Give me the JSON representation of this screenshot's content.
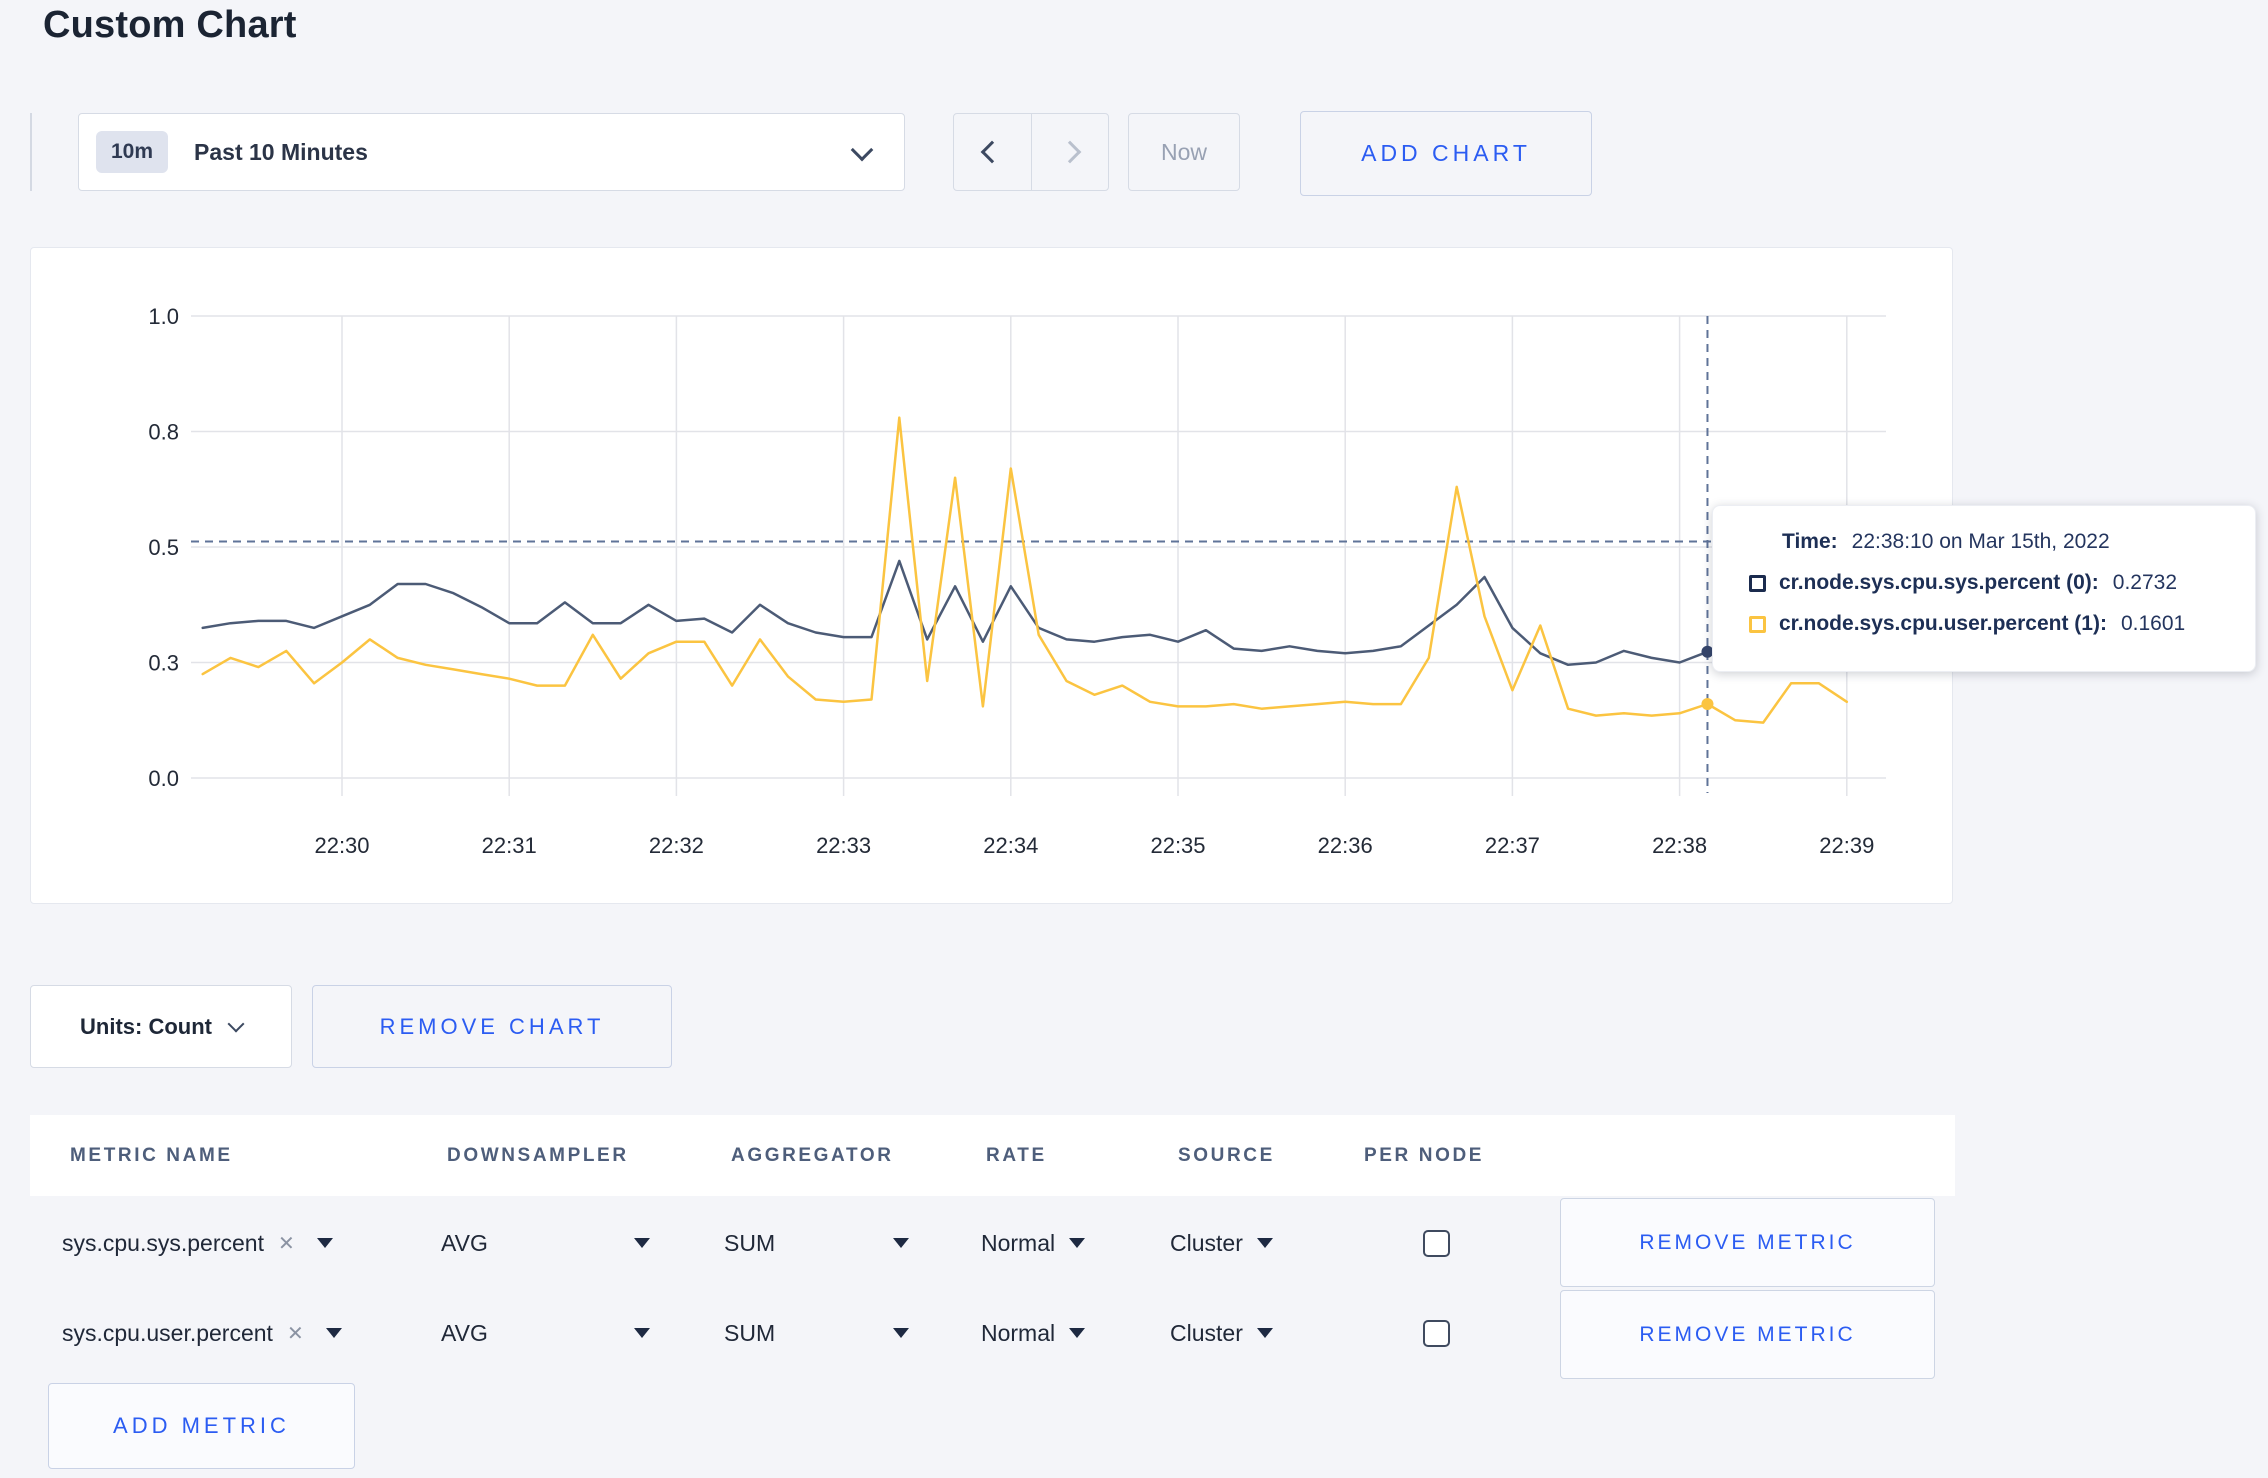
{
  "page": {
    "title": "Custom Chart"
  },
  "toolbar": {
    "time_badge": "10m",
    "time_label": "Past 10 Minutes",
    "now_label": "Now",
    "add_chart_label": "ADD CHART"
  },
  "chart_controls": {
    "units_label": "Units: Count",
    "remove_chart_label": "REMOVE CHART",
    "add_metric_label": "ADD METRIC"
  },
  "tooltip": {
    "time_label": "Time:",
    "time_value": "22:38:10 on Mar 15th, 2022",
    "rows": [
      {
        "label": "cr.node.sys.cpu.sys.percent (0):",
        "value": "0.2732",
        "color": "#1b2b4e"
      },
      {
        "label": "cr.node.sys.cpu.user.percent (1):",
        "value": "0.1601",
        "color": "#fbc441"
      }
    ]
  },
  "table": {
    "headers": [
      "METRIC NAME",
      "DOWNSAMPLER",
      "AGGREGATOR",
      "RATE",
      "SOURCE",
      "PER NODE"
    ],
    "rows": [
      {
        "metric": "sys.cpu.sys.percent",
        "downsampler": "AVG",
        "aggregator": "SUM",
        "rate": "Normal",
        "source": "Cluster",
        "per_node_checked": false,
        "remove_label": "REMOVE METRIC"
      },
      {
        "metric": "sys.cpu.user.percent",
        "downsampler": "AVG",
        "aggregator": "SUM",
        "rate": "Normal",
        "source": "Cluster",
        "per_node_checked": false,
        "remove_label": "REMOVE METRIC"
      }
    ]
  },
  "chart_data": {
    "type": "line",
    "title": "",
    "grid": true,
    "legend_position": "none",
    "x_axis": {
      "tick_labels": [
        "22:30",
        "22:31",
        "22:32",
        "22:33",
        "22:34",
        "22:35",
        "22:36",
        "22:37",
        "22:38",
        "22:39"
      ],
      "start_time": "22:29:10",
      "interval_sec": 10
    },
    "y_axis": {
      "tick_labels": [
        "0.0",
        "0.3",
        "0.5",
        "0.8",
        "1.0"
      ],
      "tick_values": [
        0,
        0.25,
        0.5,
        0.75,
        1.0
      ],
      "range": [
        0,
        1
      ]
    },
    "series": [
      {
        "name": "cr.node.sys.cpu.sys.percent",
        "color": "#4c5b76",
        "values": [
          0.325,
          0.335,
          0.34,
          0.34,
          0.325,
          0.35,
          0.375,
          0.42,
          0.42,
          0.4,
          0.37,
          0.335,
          0.335,
          0.38,
          0.335,
          0.335,
          0.375,
          0.34,
          0.345,
          0.315,
          0.375,
          0.335,
          0.315,
          0.305,
          0.305,
          0.47,
          0.3,
          0.415,
          0.295,
          0.415,
          0.325,
          0.3,
          0.295,
          0.305,
          0.31,
          0.295,
          0.32,
          0.28,
          0.275,
          0.285,
          0.275,
          0.27,
          0.275,
          0.285,
          0.33,
          0.375,
          0.435,
          0.325,
          0.27,
          0.245,
          0.25,
          0.275,
          0.26,
          0.25,
          0.2732,
          0.26,
          0.28,
          0.3,
          0.295,
          0.3
        ]
      },
      {
        "name": "cr.node.sys.cpu.user.percent",
        "color": "#fbc441",
        "values": [
          0.225,
          0.26,
          0.24,
          0.275,
          0.205,
          0.25,
          0.3,
          0.26,
          0.245,
          0.235,
          0.225,
          0.215,
          0.2,
          0.2,
          0.31,
          0.215,
          0.27,
          0.295,
          0.295,
          0.2,
          0.3,
          0.22,
          0.17,
          0.165,
          0.17,
          0.78,
          0.21,
          0.65,
          0.155,
          0.67,
          0.31,
          0.21,
          0.18,
          0.2,
          0.165,
          0.155,
          0.155,
          0.16,
          0.15,
          0.155,
          0.16,
          0.165,
          0.16,
          0.16,
          0.26,
          0.63,
          0.35,
          0.19,
          0.33,
          0.15,
          0.135,
          0.14,
          0.135,
          0.14,
          0.1601,
          0.125,
          0.12,
          0.205,
          0.205,
          0.165
        ]
      }
    ],
    "crosshair": {
      "time": "22:38:10",
      "x_index": 54,
      "y_value": 0.512,
      "point_values": [
        0.2732,
        0.1601
      ]
    }
  }
}
